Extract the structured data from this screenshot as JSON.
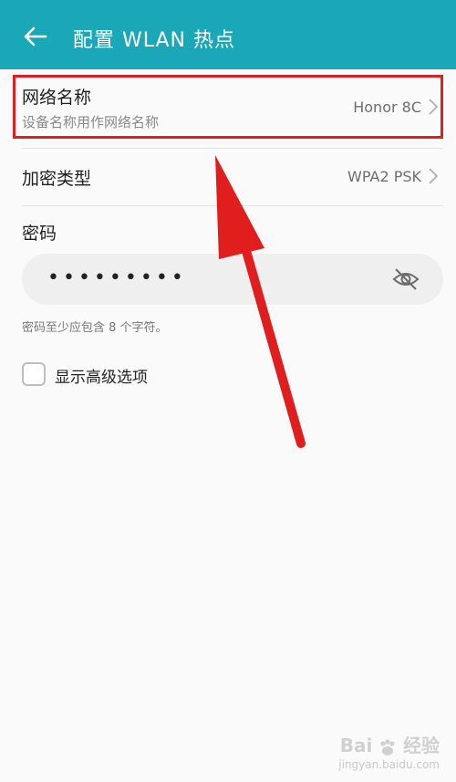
{
  "header": {
    "title": "配置 WLAN 热点"
  },
  "network_name": {
    "label": "网络名称",
    "sublabel": "设备名称用作网络名称",
    "value": "Honor 8C"
  },
  "encryption": {
    "label": "加密类型",
    "value": "WPA2 PSK"
  },
  "password": {
    "label": "密码",
    "value": "•••••••••",
    "hint": "密码至少应包含 8 个字符。"
  },
  "advanced": {
    "label": "显示高级选项",
    "checked": false
  },
  "watermark": {
    "brand_left": "Bai",
    "brand_right": "经验",
    "url": "jingyan.baidu.com"
  },
  "colors": {
    "header": "#1aa7b8",
    "highlight": "#e02020",
    "arrow": "#e01e1e",
    "background": "#fafafa"
  },
  "icons": [
    "back-arrow-icon",
    "chevron-right-icon",
    "eye-off-icon",
    "checkbox-icon",
    "baidu-paw-icon"
  ]
}
